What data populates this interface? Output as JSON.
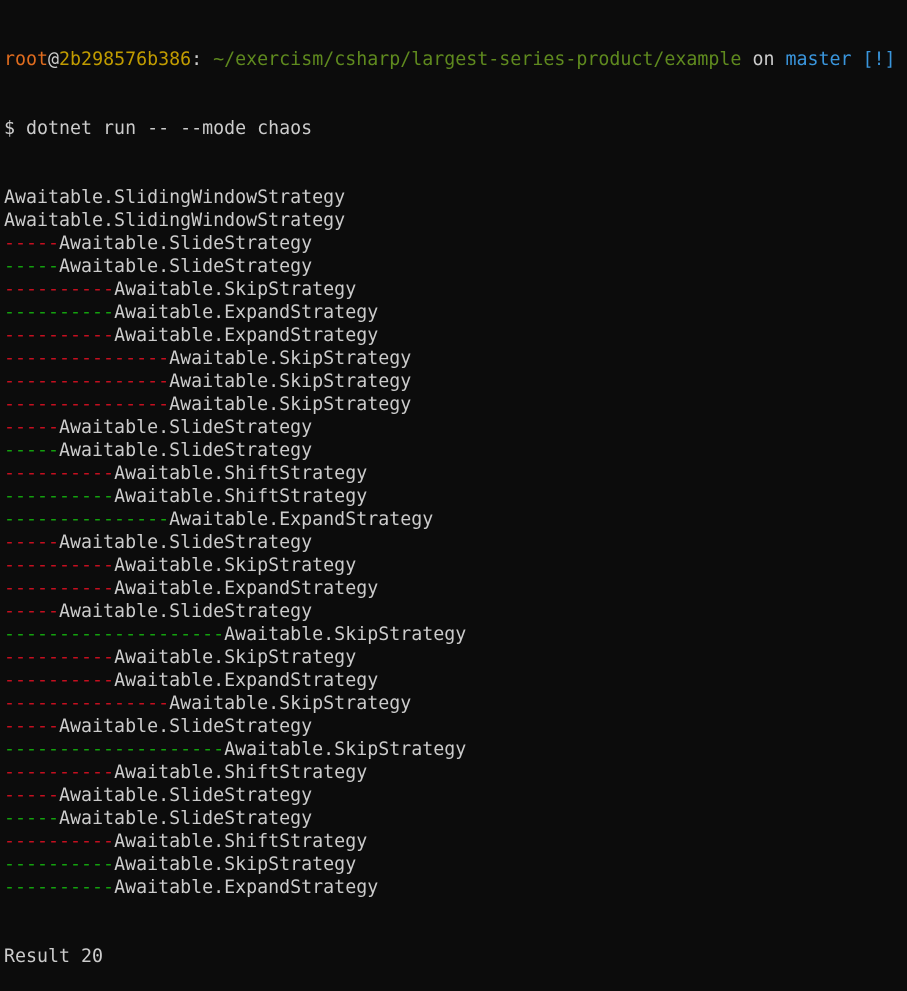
{
  "window": {
    "background": "#0c0c0c",
    "foreground": "#cccccc"
  },
  "prompt": {
    "user": "root",
    "at": "@",
    "host": "2b298576b386",
    "colon": ": ",
    "path": "~/exercism/csharp/largest-series-product/example",
    "on_word": " on ",
    "branch": "master",
    "status": " [!]",
    "colors": {
      "user": "#e06c1e",
      "host": "#c19c00",
      "path": "#5f8a1e",
      "branch": "#3a96dd"
    }
  },
  "command": "$ dotnet run -- --mode chaos",
  "output_lines": [
    {
      "dash": "",
      "dash_color": "none",
      "text": "Awaitable.SlidingWindowStrategy"
    },
    {
      "dash": "",
      "dash_color": "none",
      "text": "Awaitable.SlidingWindowStrategy"
    },
    {
      "dash": "-----",
      "dash_color": "red",
      "text": "Awaitable.SlideStrategy"
    },
    {
      "dash": "-----",
      "dash_color": "green",
      "text": "Awaitable.SlideStrategy"
    },
    {
      "dash": "----------",
      "dash_color": "red",
      "text": "Awaitable.SkipStrategy"
    },
    {
      "dash": "----------",
      "dash_color": "green",
      "text": "Awaitable.ExpandStrategy"
    },
    {
      "dash": "----------",
      "dash_color": "red",
      "text": "Awaitable.ExpandStrategy"
    },
    {
      "dash": "---------------",
      "dash_color": "red",
      "text": "Awaitable.SkipStrategy"
    },
    {
      "dash": "---------------",
      "dash_color": "red",
      "text": "Awaitable.SkipStrategy"
    },
    {
      "dash": "---------------",
      "dash_color": "red",
      "text": "Awaitable.SkipStrategy"
    },
    {
      "dash": "-----",
      "dash_color": "red",
      "text": "Awaitable.SlideStrategy"
    },
    {
      "dash": "-----",
      "dash_color": "green",
      "text": "Awaitable.SlideStrategy"
    },
    {
      "dash": "----------",
      "dash_color": "red",
      "text": "Awaitable.ShiftStrategy"
    },
    {
      "dash": "----------",
      "dash_color": "green",
      "text": "Awaitable.ShiftStrategy"
    },
    {
      "dash": "---------------",
      "dash_color": "green",
      "text": "Awaitable.ExpandStrategy"
    },
    {
      "dash": "-----",
      "dash_color": "red",
      "text": "Awaitable.SlideStrategy"
    },
    {
      "dash": "----------",
      "dash_color": "red",
      "text": "Awaitable.SkipStrategy"
    },
    {
      "dash": "----------",
      "dash_color": "red",
      "text": "Awaitable.ExpandStrategy"
    },
    {
      "dash": "-----",
      "dash_color": "red",
      "text": "Awaitable.SlideStrategy"
    },
    {
      "dash": "--------------------",
      "dash_color": "green",
      "text": "Awaitable.SkipStrategy"
    },
    {
      "dash": "----------",
      "dash_color": "red",
      "text": "Awaitable.SkipStrategy"
    },
    {
      "dash": "----------",
      "dash_color": "red",
      "text": "Awaitable.ExpandStrategy"
    },
    {
      "dash": "---------------",
      "dash_color": "red",
      "text": "Awaitable.SkipStrategy"
    },
    {
      "dash": "-----",
      "dash_color": "red",
      "text": "Awaitable.SlideStrategy"
    },
    {
      "dash": "--------------------",
      "dash_color": "green",
      "text": "Awaitable.SkipStrategy"
    },
    {
      "dash": "----------",
      "dash_color": "red",
      "text": "Awaitable.ShiftStrategy"
    },
    {
      "dash": "-----",
      "dash_color": "red",
      "text": "Awaitable.SlideStrategy"
    },
    {
      "dash": "-----",
      "dash_color": "green",
      "text": "Awaitable.SlideStrategy"
    },
    {
      "dash": "----------",
      "dash_color": "red",
      "text": "Awaitable.ShiftStrategy"
    },
    {
      "dash": "----------",
      "dash_color": "green",
      "text": "Awaitable.SkipStrategy"
    },
    {
      "dash": "----------",
      "dash_color": "green",
      "text": "Awaitable.ExpandStrategy"
    }
  ],
  "result": "Result 20",
  "dash_colors": {
    "red": "#c50f1f",
    "green": "#13a10e"
  }
}
